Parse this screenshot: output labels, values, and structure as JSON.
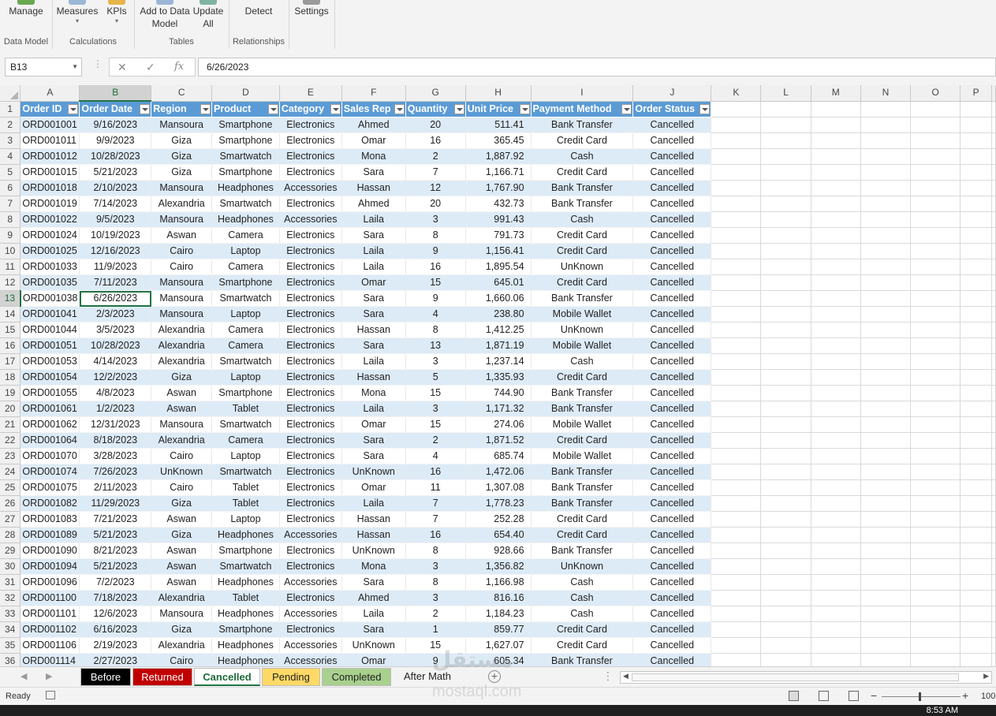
{
  "ribbon": {
    "groups": [
      {
        "label": "Data Model",
        "buttons": [
          {
            "label": "Manage"
          }
        ]
      },
      {
        "label": "Calculations",
        "buttons": [
          {
            "label": "Measures"
          },
          {
            "label": "KPIs"
          }
        ]
      },
      {
        "label": "Tables",
        "buttons": [
          {
            "label": "Add to Data Model"
          },
          {
            "label": "Update All"
          }
        ]
      },
      {
        "label": "Relationships",
        "buttons": [
          {
            "label": "Detect"
          }
        ]
      },
      {
        "label": "",
        "buttons": [
          {
            "label": "Settings"
          }
        ]
      }
    ]
  },
  "name_box": "B13",
  "formula_bar": {
    "value": "6/26/2023",
    "fx": "fx"
  },
  "grid": {
    "active_cell": "B13",
    "columns": [
      "A",
      "B",
      "C",
      "D",
      "E",
      "F",
      "G",
      "H",
      "I",
      "J",
      "K",
      "L",
      "M",
      "N",
      "O",
      "P"
    ],
    "headers": [
      "Order ID",
      "Order Date",
      "Region",
      "Product",
      "Category",
      "Sales Rep",
      "Quantity",
      "Unit Price",
      "Payment Method",
      "Order Status"
    ],
    "rows": [
      [
        "ORD001001",
        "9/16/2023",
        "Mansoura",
        "Smartphone",
        "Electronics",
        "Ahmed",
        "20",
        "511.41",
        "Bank Transfer",
        "Cancelled"
      ],
      [
        "ORD001011",
        "9/9/2023",
        "Giza",
        "Smartphone",
        "Electronics",
        "Omar",
        "16",
        "365.45",
        "Credit Card",
        "Cancelled"
      ],
      [
        "ORD001012",
        "10/28/2023",
        "Giza",
        "Smartwatch",
        "Electronics",
        "Mona",
        "2",
        "1,887.92",
        "Cash",
        "Cancelled"
      ],
      [
        "ORD001015",
        "5/21/2023",
        "Giza",
        "Smartphone",
        "Electronics",
        "Sara",
        "7",
        "1,166.71",
        "Credit Card",
        "Cancelled"
      ],
      [
        "ORD001018",
        "2/10/2023",
        "Mansoura",
        "Headphones",
        "Accessories",
        "Hassan",
        "12",
        "1,767.90",
        "Bank Transfer",
        "Cancelled"
      ],
      [
        "ORD001019",
        "7/14/2023",
        "Alexandria",
        "Smartwatch",
        "Electronics",
        "Ahmed",
        "20",
        "432.73",
        "Bank Transfer",
        "Cancelled"
      ],
      [
        "ORD001022",
        "9/5/2023",
        "Mansoura",
        "Headphones",
        "Accessories",
        "Laila",
        "3",
        "991.43",
        "Cash",
        "Cancelled"
      ],
      [
        "ORD001024",
        "10/19/2023",
        "Aswan",
        "Camera",
        "Electronics",
        "Sara",
        "8",
        "791.73",
        "Credit Card",
        "Cancelled"
      ],
      [
        "ORD001025",
        "12/16/2023",
        "Cairo",
        "Laptop",
        "Electronics",
        "Laila",
        "9",
        "1,156.41",
        "Credit Card",
        "Cancelled"
      ],
      [
        "ORD001033",
        "11/9/2023",
        "Cairo",
        "Camera",
        "Electronics",
        "Laila",
        "16",
        "1,895.54",
        "UnKnown",
        "Cancelled"
      ],
      [
        "ORD001035",
        "7/11/2023",
        "Mansoura",
        "Smartphone",
        "Electronics",
        "Omar",
        "15",
        "645.01",
        "Credit Card",
        "Cancelled"
      ],
      [
        "ORD001038",
        "6/26/2023",
        "Mansoura",
        "Smartwatch",
        "Electronics",
        "Sara",
        "9",
        "1,660.06",
        "Bank Transfer",
        "Cancelled"
      ],
      [
        "ORD001041",
        "2/3/2023",
        "Mansoura",
        "Laptop",
        "Electronics",
        "Sara",
        "4",
        "238.80",
        "Mobile Wallet",
        "Cancelled"
      ],
      [
        "ORD001044",
        "3/5/2023",
        "Alexandria",
        "Camera",
        "Electronics",
        "Hassan",
        "8",
        "1,412.25",
        "UnKnown",
        "Cancelled"
      ],
      [
        "ORD001051",
        "10/28/2023",
        "Alexandria",
        "Camera",
        "Electronics",
        "Sara",
        "13",
        "1,871.19",
        "Mobile Wallet",
        "Cancelled"
      ],
      [
        "ORD001053",
        "4/14/2023",
        "Alexandria",
        "Smartwatch",
        "Electronics",
        "Laila",
        "3",
        "1,237.14",
        "Cash",
        "Cancelled"
      ],
      [
        "ORD001054",
        "12/2/2023",
        "Giza",
        "Laptop",
        "Electronics",
        "Hassan",
        "5",
        "1,335.93",
        "Credit Card",
        "Cancelled"
      ],
      [
        "ORD001055",
        "4/8/2023",
        "Aswan",
        "Smartphone",
        "Electronics",
        "Mona",
        "15",
        "744.90",
        "Bank Transfer",
        "Cancelled"
      ],
      [
        "ORD001061",
        "1/2/2023",
        "Aswan",
        "Tablet",
        "Electronics",
        "Laila",
        "3",
        "1,171.32",
        "Bank Transfer",
        "Cancelled"
      ],
      [
        "ORD001062",
        "12/31/2023",
        "Mansoura",
        "Smartwatch",
        "Electronics",
        "Omar",
        "15",
        "274.06",
        "Mobile Wallet",
        "Cancelled"
      ],
      [
        "ORD001064",
        "8/18/2023",
        "Alexandria",
        "Camera",
        "Electronics",
        "Sara",
        "2",
        "1,871.52",
        "Credit Card",
        "Cancelled"
      ],
      [
        "ORD001070",
        "3/28/2023",
        "Cairo",
        "Laptop",
        "Electronics",
        "Sara",
        "4",
        "685.74",
        "Mobile Wallet",
        "Cancelled"
      ],
      [
        "ORD001074",
        "7/26/2023",
        "UnKnown",
        "Smartwatch",
        "Electronics",
        "UnKnown",
        "16",
        "1,472.06",
        "Bank Transfer",
        "Cancelled"
      ],
      [
        "ORD001075",
        "2/11/2023",
        "Cairo",
        "Tablet",
        "Electronics",
        "Omar",
        "11",
        "1,307.08",
        "Bank Transfer",
        "Cancelled"
      ],
      [
        "ORD001082",
        "11/29/2023",
        "Giza",
        "Tablet",
        "Electronics",
        "Laila",
        "7",
        "1,778.23",
        "Bank Transfer",
        "Cancelled"
      ],
      [
        "ORD001083",
        "7/21/2023",
        "Aswan",
        "Laptop",
        "Electronics",
        "Hassan",
        "7",
        "252.28",
        "Credit Card",
        "Cancelled"
      ],
      [
        "ORD001089",
        "5/21/2023",
        "Giza",
        "Headphones",
        "Accessories",
        "Hassan",
        "16",
        "654.40",
        "Credit Card",
        "Cancelled"
      ],
      [
        "ORD001090",
        "8/21/2023",
        "Aswan",
        "Smartphone",
        "Electronics",
        "UnKnown",
        "8",
        "928.66",
        "Bank Transfer",
        "Cancelled"
      ],
      [
        "ORD001094",
        "5/21/2023",
        "Aswan",
        "Smartwatch",
        "Electronics",
        "Mona",
        "3",
        "1,356.82",
        "UnKnown",
        "Cancelled"
      ],
      [
        "ORD001096",
        "7/2/2023",
        "Aswan",
        "Headphones",
        "Accessories",
        "Sara",
        "8",
        "1,166.98",
        "Cash",
        "Cancelled"
      ],
      [
        "ORD001100",
        "7/18/2023",
        "Alexandria",
        "Tablet",
        "Electronics",
        "Ahmed",
        "3",
        "816.16",
        "Cash",
        "Cancelled"
      ],
      [
        "ORD001101",
        "12/6/2023",
        "Mansoura",
        "Headphones",
        "Accessories",
        "Laila",
        "2",
        "1,184.23",
        "Cash",
        "Cancelled"
      ],
      [
        "ORD001102",
        "6/16/2023",
        "Giza",
        "Smartphone",
        "Electronics",
        "Sara",
        "1",
        "859.77",
        "Credit Card",
        "Cancelled"
      ],
      [
        "ORD001106",
        "2/19/2023",
        "Alexandria",
        "Headphones",
        "Accessories",
        "UnKnown",
        "15",
        "1,627.07",
        "Credit Card",
        "Cancelled"
      ],
      [
        "ORD001114",
        "2/27/2023",
        "Cairo",
        "Headphones",
        "Accessories",
        "Omar",
        "9",
        "605.34",
        "Bank Transfer",
        "Cancelled"
      ]
    ]
  },
  "sheet_tabs": [
    {
      "label": "Before",
      "bg": "#000000",
      "fg": "#ffffff"
    },
    {
      "label": "Returned",
      "bg": "#c00000",
      "fg": "#ffffff"
    },
    {
      "label": "Cancelled",
      "bg": "#ffffff",
      "fg": "#1e6b3a"
    },
    {
      "label": "Pending",
      "bg": "#ffd966",
      "fg": "#222222"
    },
    {
      "label": "Completed",
      "bg": "#a9d08e",
      "fg": "#222222"
    },
    {
      "label": "After Math",
      "bg": "#f3f3f3",
      "fg": "#222222"
    }
  ],
  "active_sheet": "Cancelled",
  "status": {
    "ready": "Ready",
    "zoom": "100",
    "time": "8:53 AM"
  },
  "watermark": {
    "arabic": "مستقل",
    "latin": "mostaql.com"
  },
  "colors": {
    "header_blue": "#5b9bd5",
    "band_blue": "#ddebf7",
    "excel_green": "#217346"
  }
}
